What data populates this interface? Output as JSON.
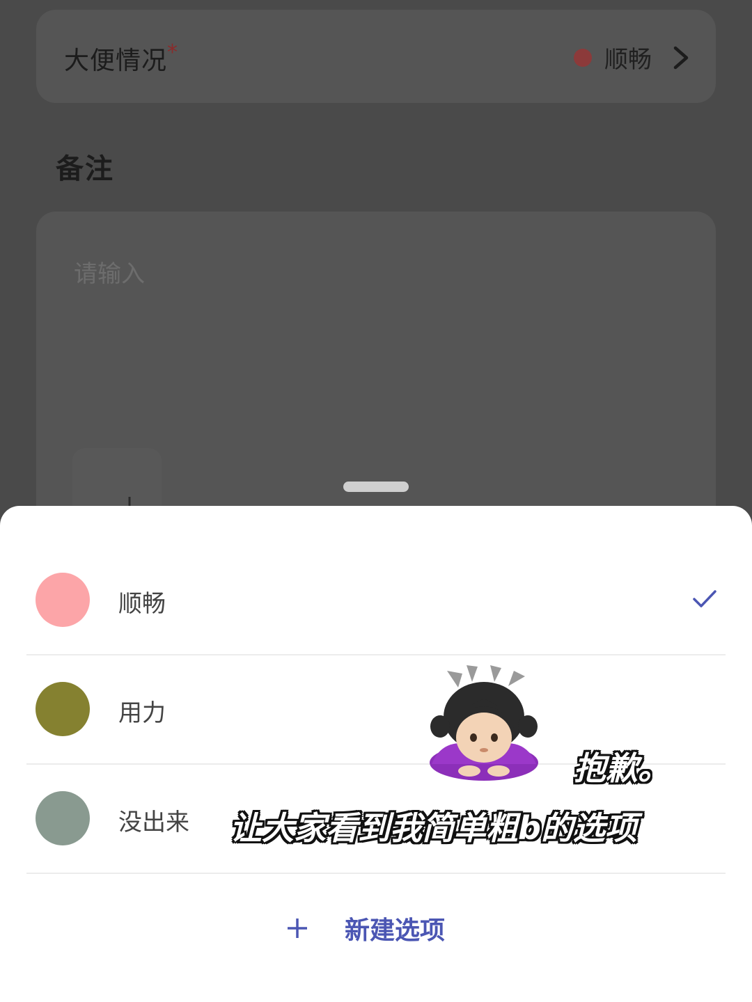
{
  "form": {
    "stool_label": "大便情况",
    "required_mark": "*",
    "stool_value": "顺畅",
    "stool_value_color": "#8c3a3a",
    "notes_heading": "备注",
    "notes_placeholder": "请输入"
  },
  "sheet": {
    "options": [
      {
        "label": "顺畅",
        "color": "#fca5a8",
        "selected": true
      },
      {
        "label": "用力",
        "color": "#858130",
        "selected": false
      },
      {
        "label": "没出来",
        "color": "#899a90",
        "selected": false
      }
    ],
    "new_option_label": "新建选项",
    "accent_color": "#4b56b3"
  },
  "overlay": {
    "caption_1": "抱歉。",
    "caption_2": "让大家看到我简单粗b的选项",
    "sticker": "person-bowing-emoji"
  }
}
